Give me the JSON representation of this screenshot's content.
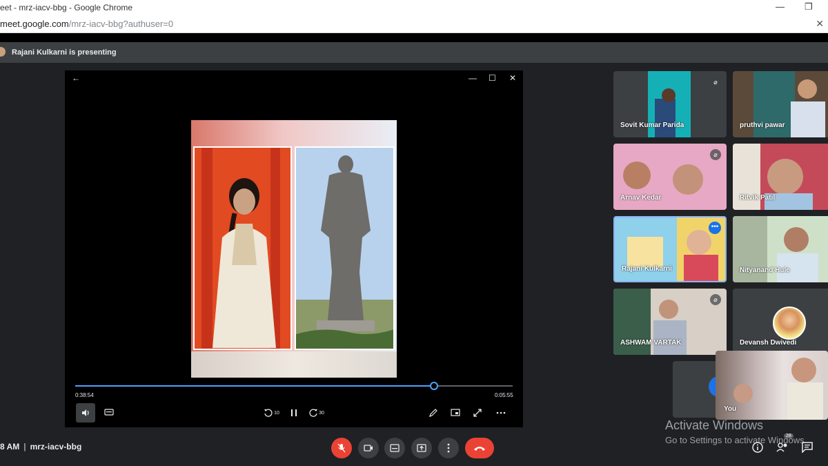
{
  "browser": {
    "window_title": "eet - mrz-iacv-bbg - Google Chrome",
    "url_host": "meet.google.com",
    "url_path": "/mrz-iacv-bbg?authuser=0",
    "minimize_glyph": "—",
    "restore_glyph": "❐",
    "close_glyph": "✕"
  },
  "presenting": {
    "text": "Rajani Kulkarni is presenting"
  },
  "player": {
    "back_glyph": "←",
    "minimize_glyph": "—",
    "maximize_glyph": "☐",
    "close_glyph": "✕",
    "elapsed": "0:38:54",
    "total": "0:05:55",
    "progress_fraction": 0.82,
    "rewind_label": "10",
    "forward_label": "30",
    "accent_color": "#4da3ff"
  },
  "participants": [
    {
      "name": "Sovit Kumar Parida",
      "muted": true
    },
    {
      "name": "pruthvi pawar",
      "muted": false
    },
    {
      "name": "Arnav Kedar",
      "muted": true
    },
    {
      "name": "Ritvik Patil",
      "muted": false
    },
    {
      "name": "Rajani Kulkarni",
      "muted": false,
      "active": true
    },
    {
      "name": "Nityanand Hule",
      "muted": false
    },
    {
      "name": "ASHWAM VARTAK",
      "muted": true
    },
    {
      "name": "Devansh Dwivedi",
      "muted": false
    }
  ],
  "self_tile": {
    "name": "You"
  },
  "watermark": {
    "line1": "Activate Windows",
    "line2": "Go to Settings to activate Windows."
  },
  "bottom_bar": {
    "time": "8 AM",
    "separator": "|",
    "meeting_code": "mrz-iacv-bbg",
    "participant_count": "28",
    "hangup_color": "#ea4335"
  }
}
